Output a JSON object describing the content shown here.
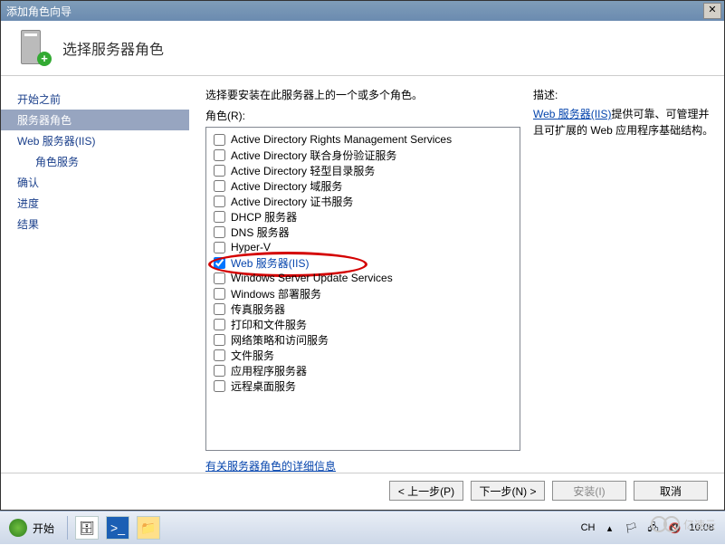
{
  "window": {
    "title": "添加角色向导"
  },
  "header": {
    "heading": "选择服务器角色"
  },
  "nav": {
    "items": [
      {
        "label": "开始之前",
        "selected": false,
        "sub": false
      },
      {
        "label": "服务器角色",
        "selected": true,
        "sub": false
      },
      {
        "label": "Web 服务器(IIS)",
        "selected": false,
        "sub": false
      },
      {
        "label": "角色服务",
        "selected": false,
        "sub": true
      },
      {
        "label": "确认",
        "selected": false,
        "sub": false
      },
      {
        "label": "进度",
        "selected": false,
        "sub": false
      },
      {
        "label": "结果",
        "selected": false,
        "sub": false
      }
    ]
  },
  "content": {
    "instruction": "选择要安装在此服务器上的一个或多个角色。",
    "roles_label": "角色(R):",
    "roles": [
      {
        "label": "Active Directory Rights Management Services",
        "checked": false
      },
      {
        "label": "Active Directory 联合身份验证服务",
        "checked": false
      },
      {
        "label": "Active Directory 轻型目录服务",
        "checked": false
      },
      {
        "label": "Active Directory 域服务",
        "checked": false
      },
      {
        "label": "Active Directory 证书服务",
        "checked": false
      },
      {
        "label": "DHCP 服务器",
        "checked": false
      },
      {
        "label": "DNS 服务器",
        "checked": false
      },
      {
        "label": "Hyper-V",
        "checked": false
      },
      {
        "label": "Web 服务器(IIS)",
        "checked": true,
        "highlight": true,
        "circled": true
      },
      {
        "label": "Windows Server Update Services",
        "checked": false
      },
      {
        "label": "Windows 部署服务",
        "checked": false
      },
      {
        "label": "传真服务器",
        "checked": false
      },
      {
        "label": "打印和文件服务",
        "checked": false
      },
      {
        "label": "网络策略和访问服务",
        "checked": false
      },
      {
        "label": "文件服务",
        "checked": false
      },
      {
        "label": "应用程序服务器",
        "checked": false
      },
      {
        "label": "远程桌面服务",
        "checked": false
      }
    ],
    "more_link": "有关服务器角色的详细信息",
    "desc_label": "描述:",
    "desc_link": "Web 服务器(IIS)",
    "desc_suffix": "提供可靠、可管理并且可扩展的 Web 应用程序基础结构。"
  },
  "buttons": {
    "prev": "< 上一步(P)",
    "next": "下一步(N) >",
    "install": "安装(I)",
    "cancel": "取消"
  },
  "taskbar": {
    "start": "开始",
    "lang": "CH",
    "time": "10:08"
  },
  "watermark": {
    "text": "亿速云"
  }
}
